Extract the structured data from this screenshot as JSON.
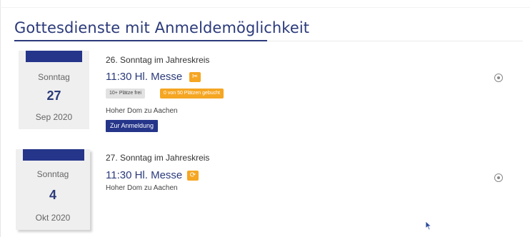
{
  "heading": "Gottesdienste mit Anmeldemöglichkeit",
  "events": [
    {
      "weekday": "Sonntag",
      "day": "27",
      "month": "Sep 2020",
      "sunday": "26. Sonntag im Jahreskreis",
      "title": "11:30 Hl. Messe",
      "badge_icon": "scissors-icon",
      "badge_glyph": "✂",
      "tag_free": "10+ Plätze frei",
      "tag_booked": "0 von 50 Plätzen gebucht",
      "location": "Hoher Dom zu Aachen",
      "button": "Zur Anmeldung"
    },
    {
      "weekday": "Sonntag",
      "day": "4",
      "month": "Okt 2020",
      "sunday": "27. Sonntag im Jahreskreis",
      "title": "11:30 Hl. Messe",
      "badge_icon": "refresh-icon",
      "badge_glyph": "⟳",
      "location": "Hoher Dom zu Aachen"
    }
  ],
  "colors": {
    "primary": "#25358a",
    "heading": "#2b3a7a",
    "accent": "#f5a623",
    "card_bg": "#efefef"
  }
}
